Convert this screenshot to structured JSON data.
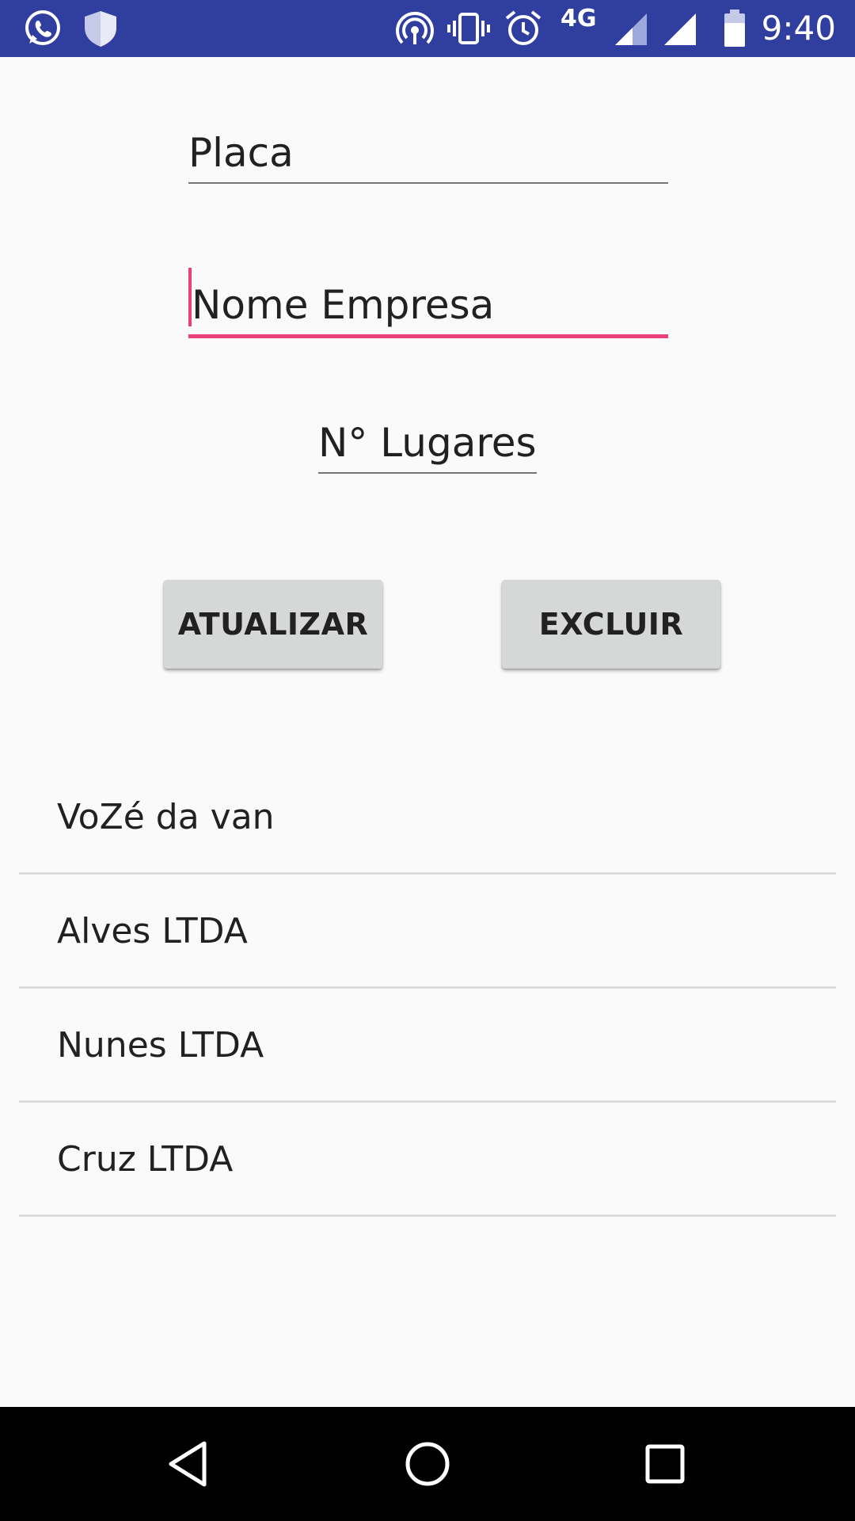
{
  "status_bar": {
    "time": "9:40",
    "network_type": "4G",
    "icons": [
      "whatsapp-icon",
      "shield-icon",
      "hotspot-icon",
      "vibrate-icon",
      "alarm-icon",
      "signal-icon",
      "wifi-signal-icon",
      "battery-icon"
    ],
    "background": "#303f9f"
  },
  "form": {
    "placa_hint": "Placa",
    "nome_empresa_hint": "Nome Empresa",
    "lugares_hint": "N° Lugares",
    "accent_color": "#ec407a"
  },
  "buttons": {
    "atualizar_label": "ATUALIZAR",
    "excluir_label": "EXCLUIR"
  },
  "list": {
    "items": [
      {
        "label": "VoZé da van"
      },
      {
        "label": "Alves LTDA"
      },
      {
        "label": "Nunes LTDA"
      },
      {
        "label": "Cruz LTDA"
      }
    ]
  },
  "nav_bar": {
    "icons": [
      "back-icon",
      "home-icon",
      "recents-icon"
    ]
  }
}
